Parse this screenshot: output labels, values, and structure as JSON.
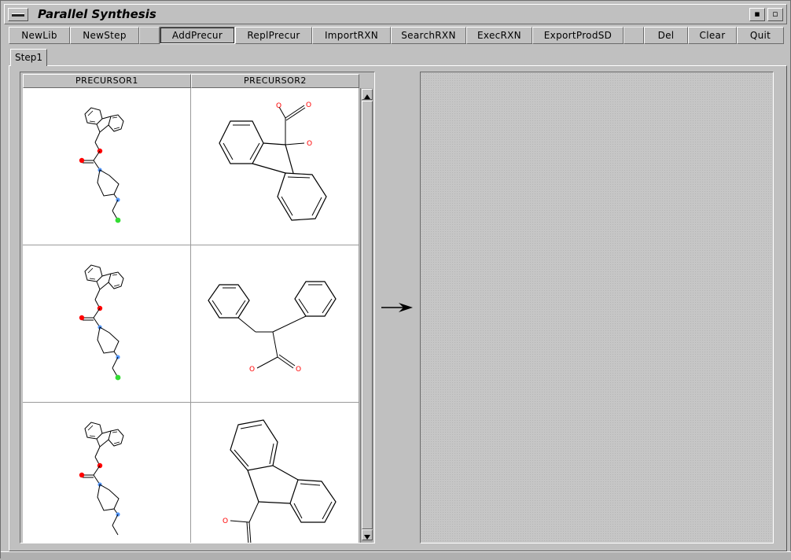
{
  "window": {
    "title": "Parallel Synthesis",
    "menu_icon": "window-menu-icon",
    "minimize_icon": "minimize-icon",
    "maximize_icon": "maximize-icon"
  },
  "toolbar": {
    "buttons": [
      {
        "label": "NewLib"
      },
      {
        "label": "NewStep"
      },
      {
        "label": "AddPrecur",
        "active": true
      },
      {
        "label": "ReplPrecur"
      },
      {
        "label": "ImportRXN"
      },
      {
        "label": "SearchRXN"
      },
      {
        "label": "ExecRXN"
      },
      {
        "label": "ExportProdSD"
      },
      {
        "label": "Del"
      },
      {
        "label": "Clear"
      },
      {
        "label": "Quit"
      }
    ]
  },
  "tabs": [
    {
      "label": "Step1",
      "selected": true
    }
  ],
  "precursor_table": {
    "columns": [
      "PRECURSOR1",
      "PRECURSOR2"
    ],
    "rows": [
      {
        "precursor1": "fmoc-piperidine-linker-structure",
        "precursor2": "9-hydroxyfluorene-9-carboxylic-acid-structure"
      },
      {
        "precursor1": "fmoc-piperidine-linker-structure",
        "precursor2": "diphenylacetic-acid-structure"
      },
      {
        "precursor1": "fmoc-piperidine-linker-structure",
        "precursor2": "fluorene-9-carboxylic-acid-structure"
      }
    ]
  },
  "reaction_arrow_icon": "right-arrow-icon",
  "colors": {
    "oxygen": "#ff0000",
    "nitrogen": "#5599ff",
    "halogen": "#33dd33",
    "bond": "#000000"
  },
  "atoms": {
    "O": "O"
  }
}
